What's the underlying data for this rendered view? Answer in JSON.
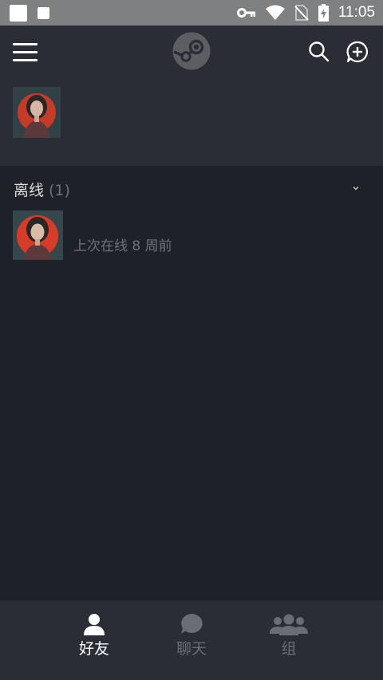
{
  "status_bar": {
    "time": "11:05",
    "icons": [
      "notification-square-icon",
      "notification-square-icon",
      "vpn-key-icon",
      "wifi-icon",
      "no-sim-icon",
      "battery-charging-icon"
    ]
  },
  "header": {
    "menu_icon": "hamburger-icon",
    "logo": "steam-logo",
    "search_icon": "search-icon",
    "add_chat_icon": "add-chat-icon"
  },
  "section": {
    "title": "离线",
    "count": "(1)"
  },
  "friends": [
    {
      "status": "上次在线 8 周前"
    }
  ],
  "bottom_nav": {
    "items": [
      {
        "label": "好友",
        "icon": "friends-icon",
        "active": true
      },
      {
        "label": "聊天",
        "icon": "chat-bubble-icon",
        "active": false
      },
      {
        "label": "组",
        "icon": "group-icon",
        "active": false
      }
    ]
  },
  "colors": {
    "status_bar": "#7f8082",
    "header": "#2a2c36",
    "background": "#1f2128",
    "muted_text": "#6f7279"
  }
}
